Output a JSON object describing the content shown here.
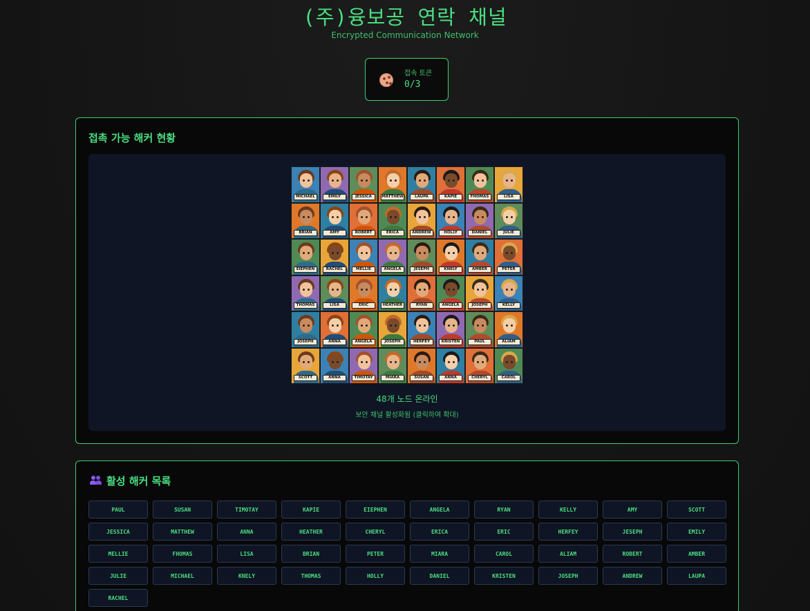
{
  "header": {
    "title": "(주)융보공 연락 채널",
    "subtitle": "Encrypted Communication Network"
  },
  "token": {
    "icon": "cookie-icon",
    "label": "접속 토큰",
    "value": "0/3"
  },
  "status_panel": {
    "title": "접촉 가능 해커 현황",
    "image": {
      "names": [
        "MICHAEL",
        "EMILY",
        "JESSICA",
        "MATTHEW",
        "LAUPA",
        "KAPIE",
        "FHOMAS",
        "LISA",
        "BRIAN",
        "AMY",
        "ROBERT",
        "ERICA",
        "ANDREW",
        "HOLLY",
        "DANIEL",
        "JULIE",
        "EIEPHEN",
        "RACHEL",
        "MELLIE",
        "ANGELA",
        "JESEPH",
        "KNELY",
        "AMBER",
        "PETER",
        "THOMAS",
        "LISA",
        "ERIC",
        "HEATHER",
        "RYAN",
        "ANGELA",
        "JOSEPH",
        "KELLY",
        "JOSEPH",
        "ANNA",
        "ANGELA",
        "JOSEPH",
        "HERFEY",
        "KRISTEN",
        "PAUL",
        "ALIAM",
        "SCOTT",
        "ANNA",
        "TIMOTAY",
        "MIARA",
        "SUSAN",
        "ANNA",
        "CHERYL",
        "CAROL"
      ]
    },
    "caption": "48개 노드 온라인",
    "subcaption": "보안 채널 활성화됨 (클릭하여 확대)"
  },
  "hackers_panel": {
    "icon": "people-icon",
    "title": "활성 해커 목록",
    "hackers": [
      "PAUL",
      "SUSAN",
      "TIMOTAY",
      "KAPIE",
      "EIEPHEN",
      "ANGELA",
      "RYAN",
      "KELLY",
      "AMY",
      "SCOTT",
      "JESSICA",
      "MATTHEW",
      "ANNA",
      "HEATHER",
      "CHERYL",
      "ERICA",
      "ERIC",
      "HERFEY",
      "JESEPH",
      "EMILY",
      "MELLIE",
      "FHOMAS",
      "LISA",
      "BRIAN",
      "PETER",
      "MIARA",
      "CAROL",
      "ALIAM",
      "ROBERT",
      "AMBER",
      "JULIE",
      "MICHAEL",
      "KNELY",
      "THOMAS",
      "HOLLY",
      "DANIEL",
      "KRISTEN",
      "JOSEPH",
      "ANDREW",
      "LAUPA",
      "RACHEL"
    ]
  }
}
